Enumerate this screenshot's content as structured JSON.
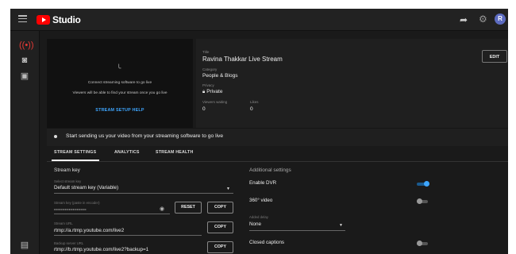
{
  "app": {
    "name": "Studio"
  },
  "preview": {
    "line1": "Connect streaming software to go live",
    "line2": "Viewers will be able to find your stream once you go live",
    "help_label": "STREAM SETUP HELP"
  },
  "info": {
    "title_label": "Title",
    "title_value": "Ravina Thakkar Live Stream",
    "category_label": "Category",
    "category_value": "People & Blogs",
    "privacy_label": "Privacy",
    "privacy_value": "Private",
    "viewers_label": "Viewers waiting",
    "viewers_value": "0",
    "likes_label": "Likes",
    "likes_value": "0",
    "edit_label": "EDIT"
  },
  "notice": {
    "text": "Start sending us your video from your streaming software to go live"
  },
  "tabs": [
    {
      "label": "STREAM SETTINGS",
      "active": true
    },
    {
      "label": "ANALYTICS",
      "active": false
    },
    {
      "label": "STREAM HEALTH",
      "active": false
    }
  ],
  "stream_key": {
    "section_title": "Stream key",
    "select_label": "Select stream key",
    "select_value": "Default stream key (Variable)",
    "key_label": "Stream key (paste in encoder)",
    "key_value": "••••••••••••••••••••••••",
    "reset_label": "RESET",
    "copy_label": "COPY",
    "url_label": "Stream URL",
    "url_value": "rtmp://a.rtmp.youtube.com/live2",
    "backup_label": "Backup server URL",
    "backup_value": "rtmp://b.rtmp.youtube.com/live2?backup=1"
  },
  "additional": {
    "section_title": "Additional settings",
    "dvr_label": "Enable DVR",
    "dvr_on": true,
    "video360_label": "360° video",
    "video360_on": false,
    "delay_label": "Added delay",
    "delay_value": "None",
    "captions_label": "Closed captions",
    "captions_on": false
  },
  "user": {
    "avatar_letter": "R"
  },
  "colors": {
    "brand_red": "#ff0000",
    "accent_blue": "#3ea6ff",
    "background": "#1a1a1a"
  }
}
